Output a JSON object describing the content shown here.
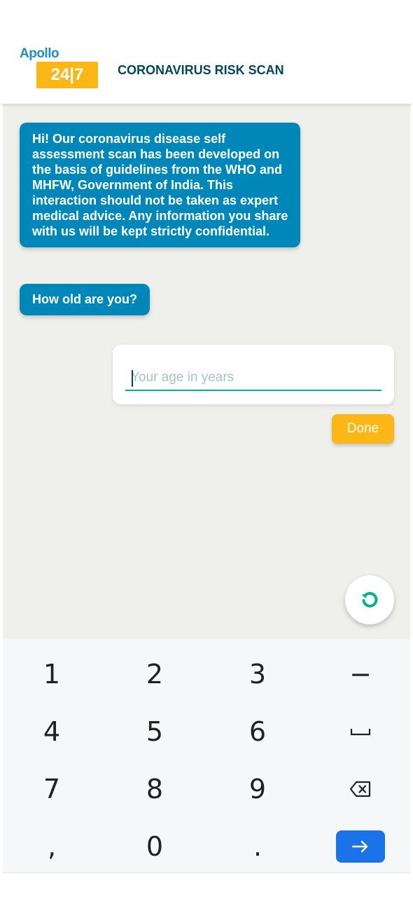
{
  "header": {
    "logo_top": "Apollo",
    "logo_bottom": "24|7",
    "title": "CORONAVIRUS RISK SCAN"
  },
  "chat": {
    "intro_message": "Hi! Our coronavirus disease self assessment scan has been developed on the basis of guidelines from the WHO and MHFW, Government of India. This interaction should not be taken as expert medical advice. Any information you share with us will be kept strictly confidential.",
    "question_message": "How old are you?"
  },
  "age_input": {
    "placeholder": "Your age in years",
    "value": ""
  },
  "done_button": {
    "label": "Done"
  },
  "reset_button": {
    "icon": "refresh-icon"
  },
  "keyboard": {
    "rows": [
      [
        "1",
        "2",
        "3",
        "−"
      ],
      [
        "4",
        "5",
        "6",
        "space"
      ],
      [
        "7",
        "8",
        "9",
        "backspace"
      ],
      [
        ",",
        "0",
        ".",
        "go"
      ]
    ]
  },
  "colors": {
    "bubble": "#0087ba",
    "accent_yellow": "#fcb716",
    "title_text": "#02475b",
    "input_underline": "#00b38e",
    "chat_background": "#efefeb",
    "go_key": "#1a73e8"
  }
}
